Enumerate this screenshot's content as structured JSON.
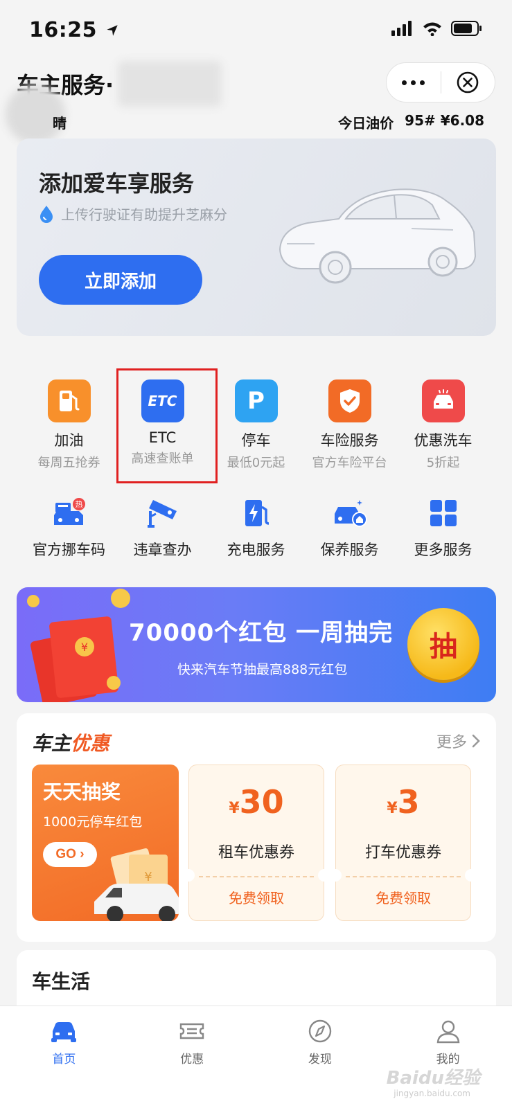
{
  "status": {
    "time": "16:25"
  },
  "header": {
    "title": "车主服务·",
    "weather": "晴",
    "oil_label": "今日油价",
    "oil_grade": "95#",
    "oil_price": "¥6.08"
  },
  "add_car": {
    "title": "添加爱车享服务",
    "subtitle": "上传行驶证有助提升芝麻分",
    "button": "立即添加"
  },
  "services_row1": [
    {
      "title": "加油",
      "sub": "每周五抢券",
      "icon": "fuel-icon",
      "color": "#f8902b"
    },
    {
      "title": "ETC",
      "sub": "高速查账单",
      "icon": "etc-icon",
      "color": "#2e6ef0"
    },
    {
      "title": "停车",
      "sub": "最低0元起",
      "icon": "parking-icon",
      "color": "#2ea3f2"
    },
    {
      "title": "车险服务",
      "sub": "官方车险平台",
      "icon": "shield-icon",
      "color": "#f26b26"
    },
    {
      "title": "优惠洗车",
      "sub": "5折起",
      "icon": "car-wash-icon",
      "color": "#ef4a4a"
    }
  ],
  "services_row2": [
    {
      "title": "官方挪车码",
      "icon": "move-car-icon",
      "badge": "热"
    },
    {
      "title": "违章查办",
      "icon": "camera-icon"
    },
    {
      "title": "充电服务",
      "icon": "charging-icon"
    },
    {
      "title": "保养服务",
      "icon": "maintenance-icon"
    },
    {
      "title": "更多服务",
      "icon": "grid-icon"
    }
  ],
  "promo": {
    "title": "70000个红包 一周抽完",
    "subtitle": "快来汽车节抽最高888元红包",
    "button": "抽"
  },
  "deals": {
    "title_a": "车主",
    "title_b": "优惠",
    "more": "更多",
    "lottery": {
      "title": "天天抽奖",
      "sub": "1000元停车红包",
      "go": "GO"
    },
    "coupons": [
      {
        "symbol": "¥",
        "amount": "30",
        "name": "租车优惠券",
        "claim": "免费领取"
      },
      {
        "symbol": "¥",
        "amount": "3",
        "name": "打车优惠券",
        "claim": "免费领取"
      }
    ]
  },
  "life": {
    "title": "车生活"
  },
  "tabs": [
    {
      "label": "首页",
      "icon": "car-icon",
      "active": true
    },
    {
      "label": "优惠",
      "icon": "ticket-icon"
    },
    {
      "label": "发现",
      "icon": "compass-icon"
    },
    {
      "label": "我的",
      "icon": "user-icon"
    }
  ],
  "watermark": {
    "text": "Baidu经验",
    "sub": "jingyan.baidu.com"
  },
  "colors": {
    "primary": "#2e6ef0",
    "accent": "#f05a24",
    "highlight": "#e02020"
  }
}
